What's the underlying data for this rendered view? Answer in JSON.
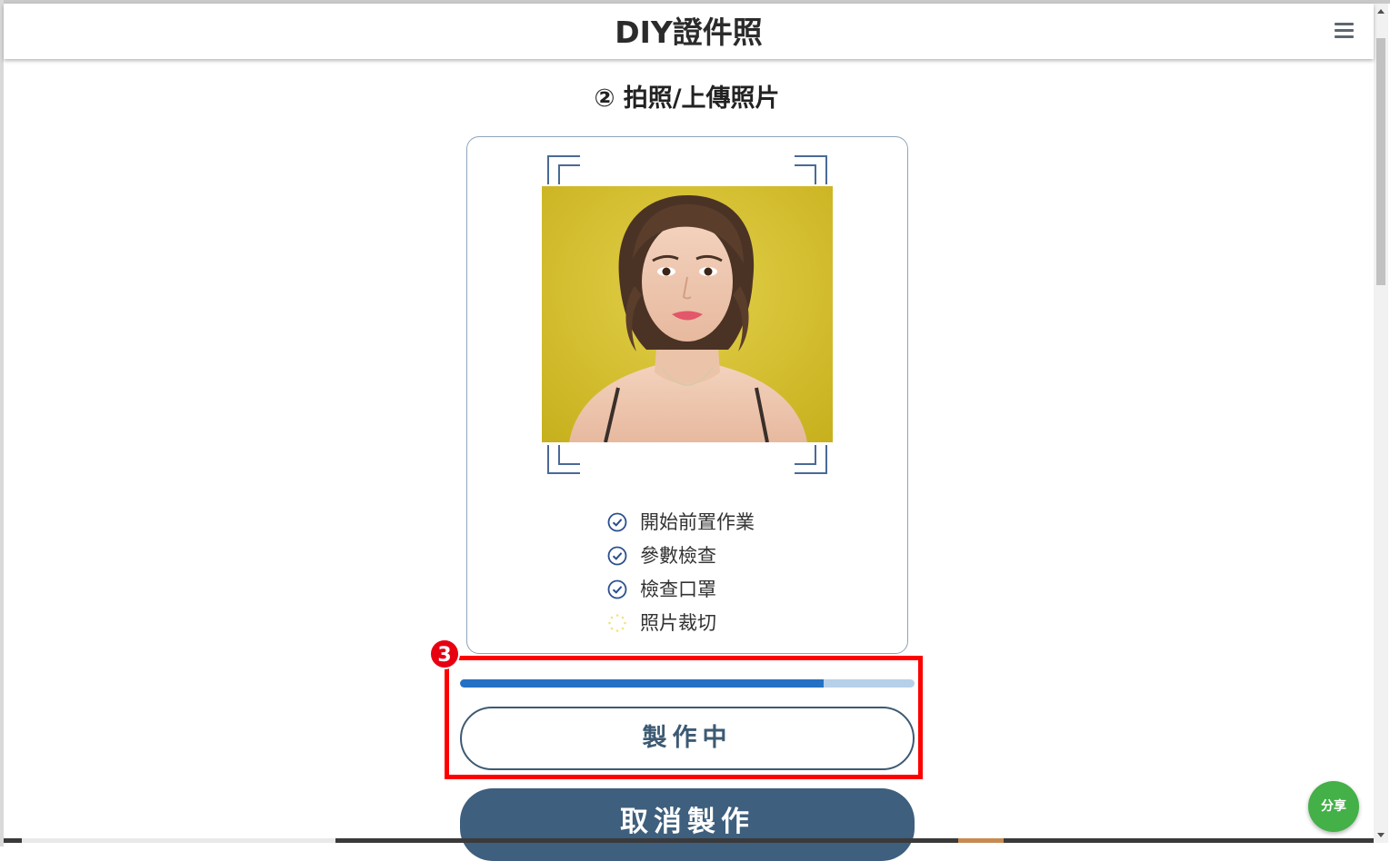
{
  "header": {
    "title": "DIY證件照",
    "menu_icon": "hamburger-menu-icon"
  },
  "step": {
    "title": "② 拍照/上傳照片"
  },
  "photo": {
    "description_icon": "portrait-photo",
    "background_color": "#d4bf2c"
  },
  "checklist": [
    {
      "label": "開始前置作業",
      "status": "done",
      "icon": "check-circle-icon"
    },
    {
      "label": "參數檢查",
      "status": "done",
      "icon": "check-circle-icon"
    },
    {
      "label": "檢查口罩",
      "status": "done",
      "icon": "check-circle-icon"
    },
    {
      "label": "照片裁切",
      "status": "loading",
      "icon": "loading-spinner-icon"
    }
  ],
  "annotation": {
    "badge": "3",
    "color": "#ff0000"
  },
  "progress": {
    "value": 0.8,
    "fill_color": "#2471c3",
    "track_color": "#b7d0ea"
  },
  "buttons": {
    "making": "製作中",
    "cancel": "取消製作"
  },
  "share": {
    "label": "分享",
    "color": "#43b048"
  },
  "colors": {
    "primary": "#3e5f7d",
    "check": "#2b4f8f"
  }
}
